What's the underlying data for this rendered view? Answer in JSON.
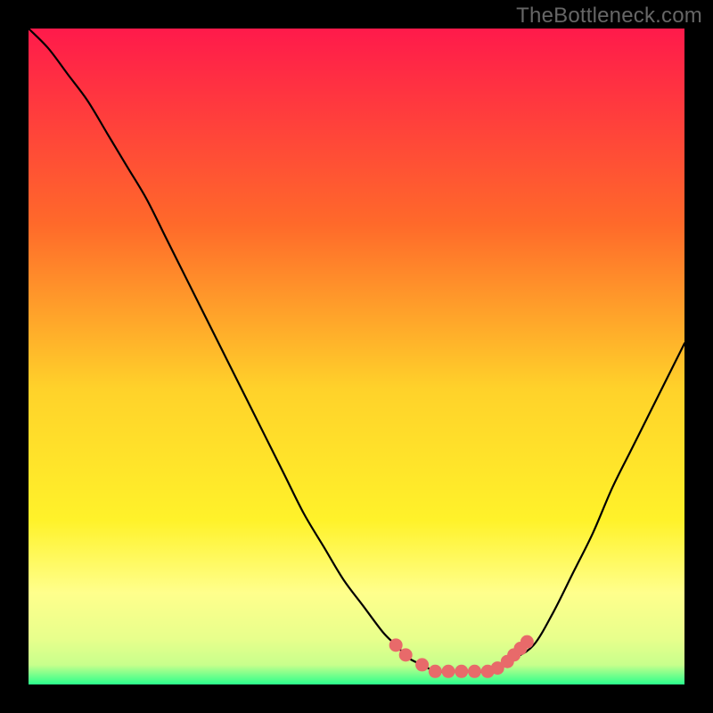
{
  "watermark": "TheBottleneck.com",
  "colors": {
    "gradient_top": "#ff1a4b",
    "gradient_mid1": "#ffb02a",
    "gradient_mid2": "#fff22a",
    "gradient_mid3": "#ffff8c",
    "gradient_bottom1": "#c8ff8c",
    "gradient_bottom2": "#2aff8c",
    "curve": "#000000",
    "marker": "#e86a6a"
  },
  "chart_data": {
    "type": "line",
    "title": "",
    "xlabel": "",
    "ylabel": "",
    "xlim": [
      0,
      100
    ],
    "ylim": [
      0,
      100
    ],
    "series": [
      {
        "name": "bottleneck-curve",
        "x": [
          0,
          3,
          6,
          9,
          12,
          15,
          18,
          21,
          24,
          27,
          30,
          33,
          36,
          39,
          42,
          45,
          48,
          51,
          54,
          56,
          58,
          60,
          62,
          64,
          66,
          68,
          70,
          72,
          74,
          77,
          80,
          83,
          86,
          89,
          92,
          95,
          98,
          100
        ],
        "y": [
          100,
          97,
          93,
          89,
          84,
          79,
          74,
          68,
          62,
          56,
          50,
          44,
          38,
          32,
          26,
          21,
          16,
          12,
          8,
          6,
          4,
          3,
          2,
          2,
          2,
          2,
          2,
          3,
          4,
          6,
          11,
          17,
          23,
          30,
          36,
          42,
          48,
          52
        ]
      }
    ],
    "markers": {
      "name": "highlight-dots",
      "points": [
        {
          "x": 56,
          "y": 6
        },
        {
          "x": 57.5,
          "y": 4.5
        },
        {
          "x": 60,
          "y": 3
        },
        {
          "x": 62,
          "y": 2
        },
        {
          "x": 64,
          "y": 2
        },
        {
          "x": 66,
          "y": 2
        },
        {
          "x": 68,
          "y": 2
        },
        {
          "x": 70,
          "y": 2
        },
        {
          "x": 71.5,
          "y": 2.5
        },
        {
          "x": 73,
          "y": 3.5
        },
        {
          "x": 74,
          "y": 4.5
        },
        {
          "x": 75,
          "y": 5.5
        },
        {
          "x": 76,
          "y": 6.5
        }
      ]
    }
  }
}
